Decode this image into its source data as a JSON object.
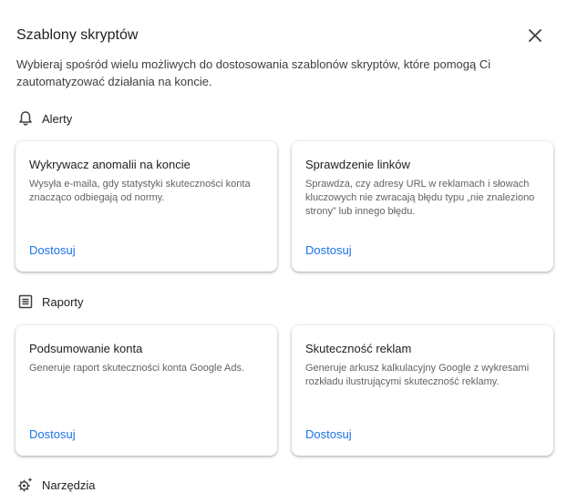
{
  "dialog": {
    "title": "Szablony skryptów",
    "description": "Wybieraj spośród wielu możliwych do dostosowania szablonów skryptów, które pomogą Ci zautomatyzować działania na koncie."
  },
  "icons": {
    "close": "close-icon",
    "alerts": "bell-icon",
    "reports": "report-icon",
    "tools": "tools-icon"
  },
  "sections": {
    "alerts": {
      "label": "Alerty",
      "cards": [
        {
          "title": "Wykrywacz anomalii na koncie",
          "description": "Wysyła e-maila, gdy statystyki skuteczności konta znacząco odbiegają od normy.",
          "link": "Dostosuj"
        },
        {
          "title": "Sprawdzenie linków",
          "description": "Sprawdza, czy adresy URL w reklamach i słowach kluczowych nie zwracają błędu typu „nie znaleziono strony” lub innego błędu.",
          "link": "Dostosuj"
        }
      ]
    },
    "reports": {
      "label": "Raporty",
      "cards": [
        {
          "title": "Podsumowanie konta",
          "description": "Generuje raport skuteczności konta Google Ads.",
          "link": "Dostosuj"
        },
        {
          "title": "Skuteczność reklam",
          "description": "Generuje arkusz kalkulacyjny Google z wykresami rozkładu ilustrującymi skuteczność reklamy.",
          "link": "Dostosuj"
        }
      ]
    },
    "tools": {
      "label": "Narzędzia"
    }
  },
  "colors": {
    "link": "#1a73e8",
    "text": "#202124",
    "secondary_text": "#5f6368"
  }
}
